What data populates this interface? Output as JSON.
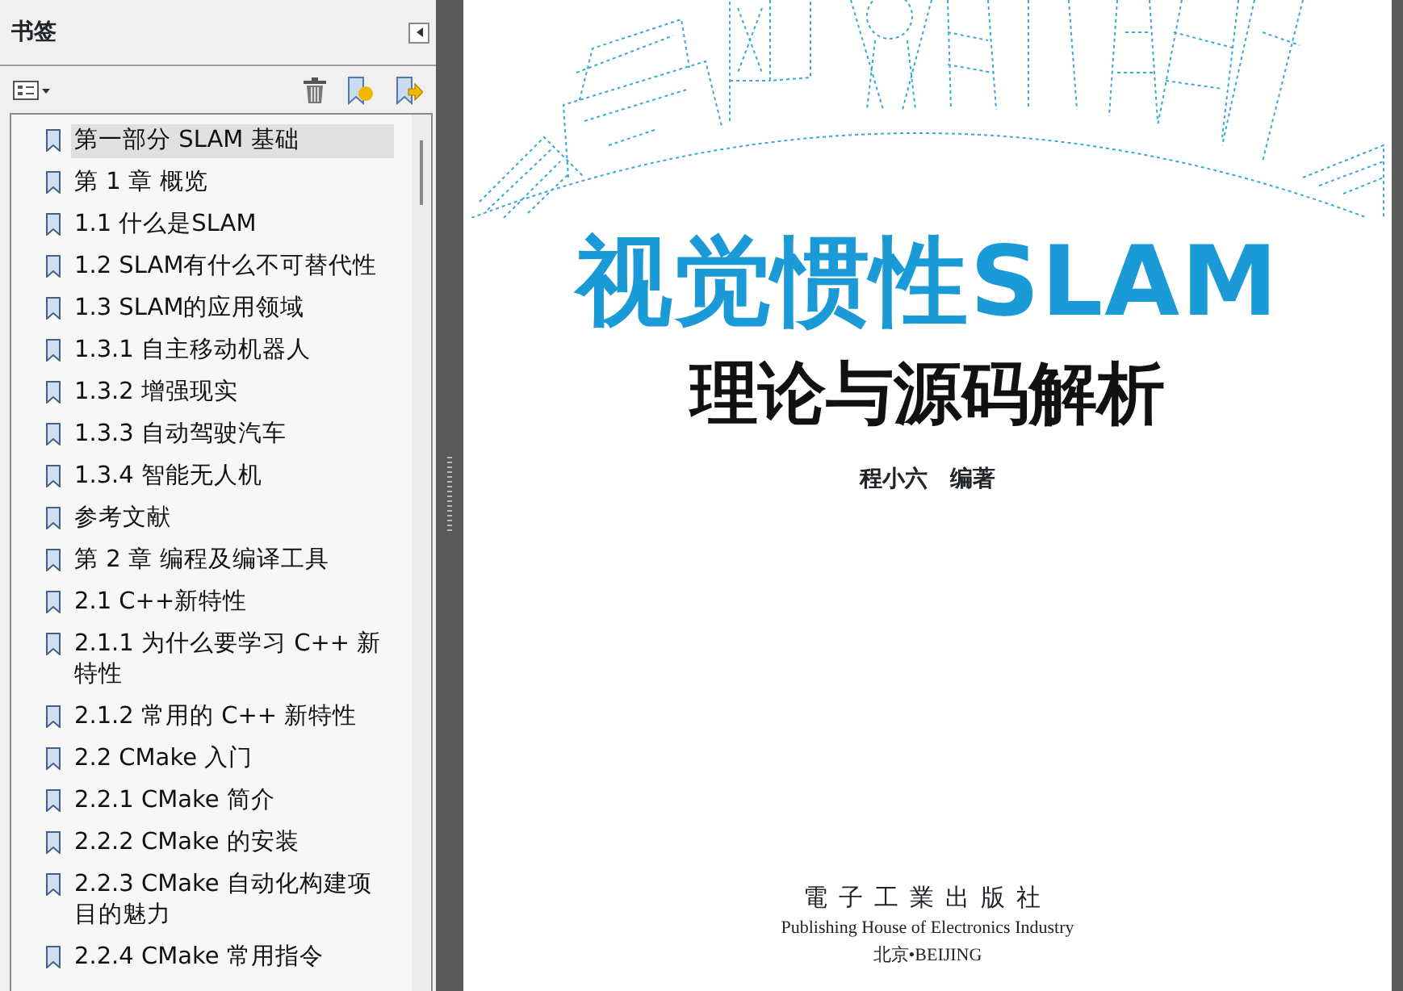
{
  "bookmarks_panel": {
    "title": "书签",
    "items": [
      {
        "label": "第一部分 SLAM 基础",
        "selected": true
      },
      {
        "label": "第 1 章 概览",
        "selected": false
      },
      {
        "label": "1.1 什么是SLAM",
        "selected": false
      },
      {
        "label": "1.2 SLAM有什么不可替代性",
        "selected": false
      },
      {
        "label": "1.3 SLAM的应用领域",
        "selected": false
      },
      {
        "label": "1.3.1 自主移动机器人",
        "selected": false
      },
      {
        "label": "1.3.2 增强现实",
        "selected": false
      },
      {
        "label": "1.3.3 自动驾驶汽车",
        "selected": false
      },
      {
        "label": "1.3.4 智能无人机",
        "selected": false
      },
      {
        "label": "参考文献",
        "selected": false
      },
      {
        "label": "第 2 章 编程及编译工具",
        "selected": false
      },
      {
        "label": "2.1 C++新特性",
        "selected": false
      },
      {
        "label": "2.1.1 为什么要学习 C++ 新特性",
        "selected": false
      },
      {
        "label": "2.1.2 常用的 C++ 新特性",
        "selected": false
      },
      {
        "label": "2.2 CMake 入门",
        "selected": false
      },
      {
        "label": "2.2.1 CMake 简介",
        "selected": false
      },
      {
        "label": "2.2.2 CMake 的安装",
        "selected": false
      },
      {
        "label": "2.2.3 CMake 自动化构建项目的魅力",
        "selected": false
      },
      {
        "label": "2.2.4 CMake 常用指令",
        "selected": false
      }
    ]
  },
  "document_page": {
    "title": "视觉惯性SLAM",
    "subtitle": "理论与源码解析",
    "author": "程小六　编著",
    "publisher_cn": "電子工業出版社",
    "publisher_en": "Publishing House of Electronics Industry",
    "city": "北京•BEIJING"
  }
}
